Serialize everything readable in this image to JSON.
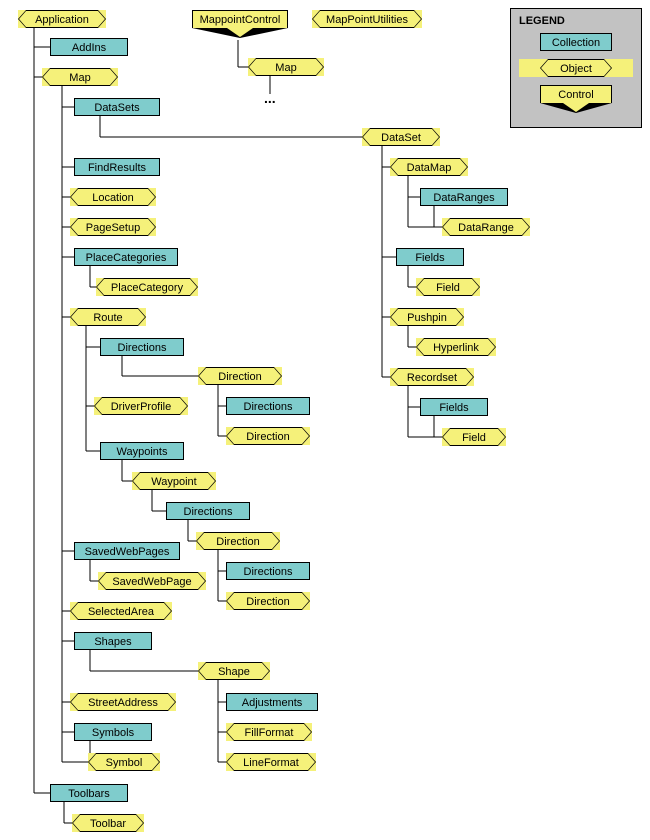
{
  "legend": {
    "title": "LEGEND",
    "collection": "Collection",
    "object": "Object",
    "control": "Control"
  },
  "top": {
    "mappointControl": "MappointControl",
    "mapPointUtilities": "MapPointUtilities",
    "map": "Map",
    "dots": "..."
  },
  "app": {
    "application": "Application",
    "addIns": "AddIns",
    "map": "Map",
    "dataSets": "DataSets",
    "findResults": "FindResults",
    "location": "Location",
    "pageSetup": "PageSetup",
    "placeCategories": "PlaceCategories",
    "placeCategory": "PlaceCategory",
    "route": "Route",
    "directions1": "Directions",
    "direction1": "Direction",
    "directions1b": "Directions",
    "direction1b": "Direction",
    "driverProfile": "DriverProfile",
    "waypoints": "Waypoints",
    "waypoint": "Waypoint",
    "directions2": "Directions",
    "direction2": "Direction",
    "directions2b": "Directions",
    "direction2b": "Direction",
    "savedWebPages": "SavedWebPages",
    "savedWebPage": "SavedWebPage",
    "selectedArea": "SelectedArea",
    "shapes": "Shapes",
    "shape": "Shape",
    "adjustments": "Adjustments",
    "fillFormat": "FillFormat",
    "lineFormat": "LineFormat",
    "streetAddress": "StreetAddress",
    "symbols": "Symbols",
    "symbol": "Symbol",
    "toolbars": "Toolbars",
    "toolbar": "Toolbar"
  },
  "dataset": {
    "dataSet": "DataSet",
    "dataMap": "DataMap",
    "dataRanges": "DataRanges",
    "dataRange": "DataRange",
    "fields": "Fields",
    "field": "Field",
    "pushpin": "Pushpin",
    "hyperlink": "Hyperlink",
    "recordset": "Recordset",
    "fields2": "Fields",
    "field2": "Field"
  },
  "chart_data": {
    "type": "tree",
    "node_types": [
      "Collection",
      "Object",
      "Control"
    ],
    "roots": [
      {
        "name": "Application",
        "type": "Object",
        "children": [
          {
            "name": "AddIns",
            "type": "Collection"
          },
          {
            "name": "Map",
            "type": "Object",
            "children": [
              {
                "name": "DataSets",
                "type": "Collection",
                "children": [
                  {
                    "name": "DataSet",
                    "type": "Object",
                    "children": [
                      {
                        "name": "DataMap",
                        "type": "Object",
                        "children": [
                          {
                            "name": "DataRanges",
                            "type": "Collection",
                            "children": [
                              {
                                "name": "DataRange",
                                "type": "Object"
                              }
                            ]
                          }
                        ]
                      },
                      {
                        "name": "Fields",
                        "type": "Collection",
                        "children": [
                          {
                            "name": "Field",
                            "type": "Object"
                          }
                        ]
                      },
                      {
                        "name": "Pushpin",
                        "type": "Object",
                        "children": [
                          {
                            "name": "Hyperlink",
                            "type": "Object"
                          }
                        ]
                      },
                      {
                        "name": "Recordset",
                        "type": "Object",
                        "children": [
                          {
                            "name": "Fields",
                            "type": "Collection",
                            "children": [
                              {
                                "name": "Field",
                                "type": "Object"
                              }
                            ]
                          }
                        ]
                      }
                    ]
                  }
                ]
              },
              {
                "name": "FindResults",
                "type": "Collection"
              },
              {
                "name": "Location",
                "type": "Object"
              },
              {
                "name": "PageSetup",
                "type": "Object"
              },
              {
                "name": "PlaceCategories",
                "type": "Collection",
                "children": [
                  {
                    "name": "PlaceCategory",
                    "type": "Object"
                  }
                ]
              },
              {
                "name": "Route",
                "type": "Object",
                "children": [
                  {
                    "name": "Directions",
                    "type": "Collection",
                    "children": [
                      {
                        "name": "Direction",
                        "type": "Object",
                        "children": [
                          {
                            "name": "Directions",
                            "type": "Collection",
                            "children": [
                              {
                                "name": "Direction",
                                "type": "Object"
                              }
                            ]
                          }
                        ]
                      }
                    ]
                  },
                  {
                    "name": "DriverProfile",
                    "type": "Object"
                  },
                  {
                    "name": "Waypoints",
                    "type": "Collection",
                    "children": [
                      {
                        "name": "Waypoint",
                        "type": "Object",
                        "children": [
                          {
                            "name": "Directions",
                            "type": "Collection",
                            "children": [
                              {
                                "name": "Direction",
                                "type": "Object",
                                "children": [
                                  {
                                    "name": "Directions",
                                    "type": "Collection",
                                    "children": [
                                      {
                                        "name": "Direction",
                                        "type": "Object"
                                      }
                                    ]
                                  }
                                ]
                              }
                            ]
                          }
                        ]
                      }
                    ]
                  }
                ]
              },
              {
                "name": "SavedWebPages",
                "type": "Collection",
                "children": [
                  {
                    "name": "SavedWebPage",
                    "type": "Object"
                  }
                ]
              },
              {
                "name": "SelectedArea",
                "type": "Object"
              },
              {
                "name": "Shapes",
                "type": "Collection",
                "children": [
                  {
                    "name": "Shape",
                    "type": "Object",
                    "children": [
                      {
                        "name": "Adjustments",
                        "type": "Collection"
                      },
                      {
                        "name": "FillFormat",
                        "type": "Object"
                      },
                      {
                        "name": "LineFormat",
                        "type": "Object"
                      }
                    ]
                  }
                ]
              },
              {
                "name": "StreetAddress",
                "type": "Object"
              },
              {
                "name": "Symbols",
                "type": "Collection",
                "children": [
                  {
                    "name": "Symbol",
                    "type": "Object"
                  }
                ]
              }
            ]
          },
          {
            "name": "Toolbars",
            "type": "Collection",
            "children": [
              {
                "name": "Toolbar",
                "type": "Object"
              }
            ]
          }
        ]
      },
      {
        "name": "MappointControl",
        "type": "Control",
        "children": [
          {
            "name": "Map",
            "type": "Object",
            "children": "..."
          }
        ]
      },
      {
        "name": "MapPointUtilities",
        "type": "Object"
      }
    ]
  }
}
